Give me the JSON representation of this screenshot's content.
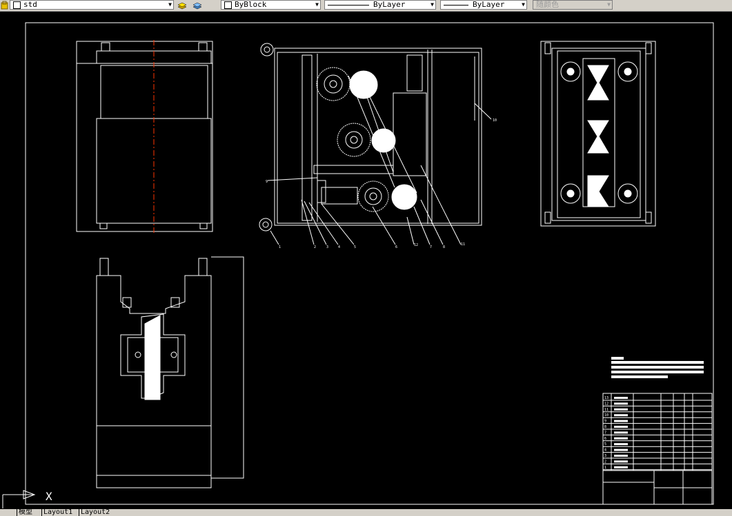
{
  "toolbar": {
    "layer_name": "std",
    "color_value": "ByBlock",
    "linetype_value": "ByLayer",
    "lineweight_value": "ByLayer",
    "plotstyle_value": "随颜色",
    "icons": [
      "layer-state-icon",
      "layer-previous-icon",
      "layers-icon"
    ]
  },
  "drawing": {
    "balloon_labels": [
      "1",
      "2",
      "3",
      "4",
      "5",
      "6",
      "12",
      "7",
      "8",
      "9",
      "10",
      "11"
    ],
    "ucs_label": "X",
    "title_block_rows": [
      "13",
      "12",
      "11",
      "10",
      "9",
      "8",
      "7",
      "6",
      "5",
      "4",
      "3",
      "2",
      "1"
    ]
  },
  "status": {
    "tabs": [
      "模型",
      "Layout1",
      "Layout2"
    ]
  },
  "colors": {
    "toolbar_bg": "#d4d0c8",
    "canvas_bg": "#000000",
    "drawing_lines": "#ffffff",
    "centerline": "#ff3300"
  }
}
